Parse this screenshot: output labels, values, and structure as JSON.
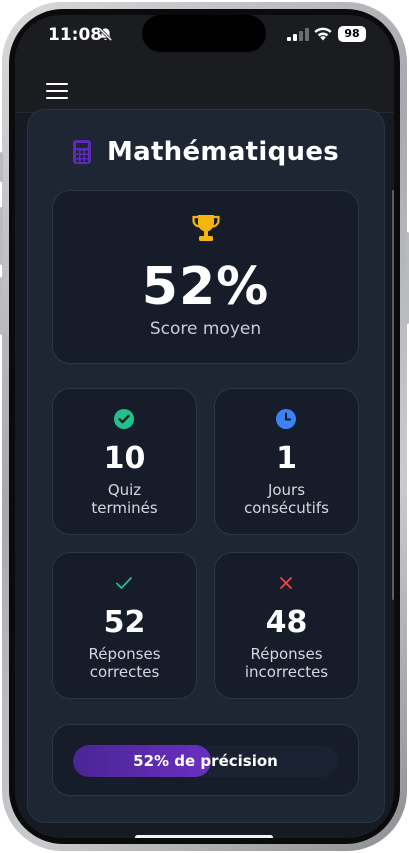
{
  "status_bar": {
    "time": "11:08",
    "battery": "98"
  },
  "subject": {
    "title": "Mathématiques",
    "icon": "calculator-icon",
    "accent_color": "#5b2bb8"
  },
  "score": {
    "value": "52%",
    "label": "Score moyen",
    "icon": "trophy-icon"
  },
  "stats": [
    {
      "value": "10",
      "label_line1": "Quiz",
      "label_line2": "terminés",
      "icon": "check-circle-icon",
      "color": "#22c08a"
    },
    {
      "value": "1",
      "label_line1": "Jours",
      "label_line2": "consécutifs",
      "icon": "clock-icon",
      "color": "#3b82f6"
    },
    {
      "value": "52",
      "label_line1": "Réponses",
      "label_line2": "correctes",
      "icon": "check-icon",
      "color": "#22c08a"
    },
    {
      "value": "48",
      "label_line1": "Réponses",
      "label_line2": "incorrectes",
      "icon": "x-icon",
      "color": "#ef4444"
    }
  ],
  "precision": {
    "label": "52% de précision",
    "fraction": 0.52
  }
}
